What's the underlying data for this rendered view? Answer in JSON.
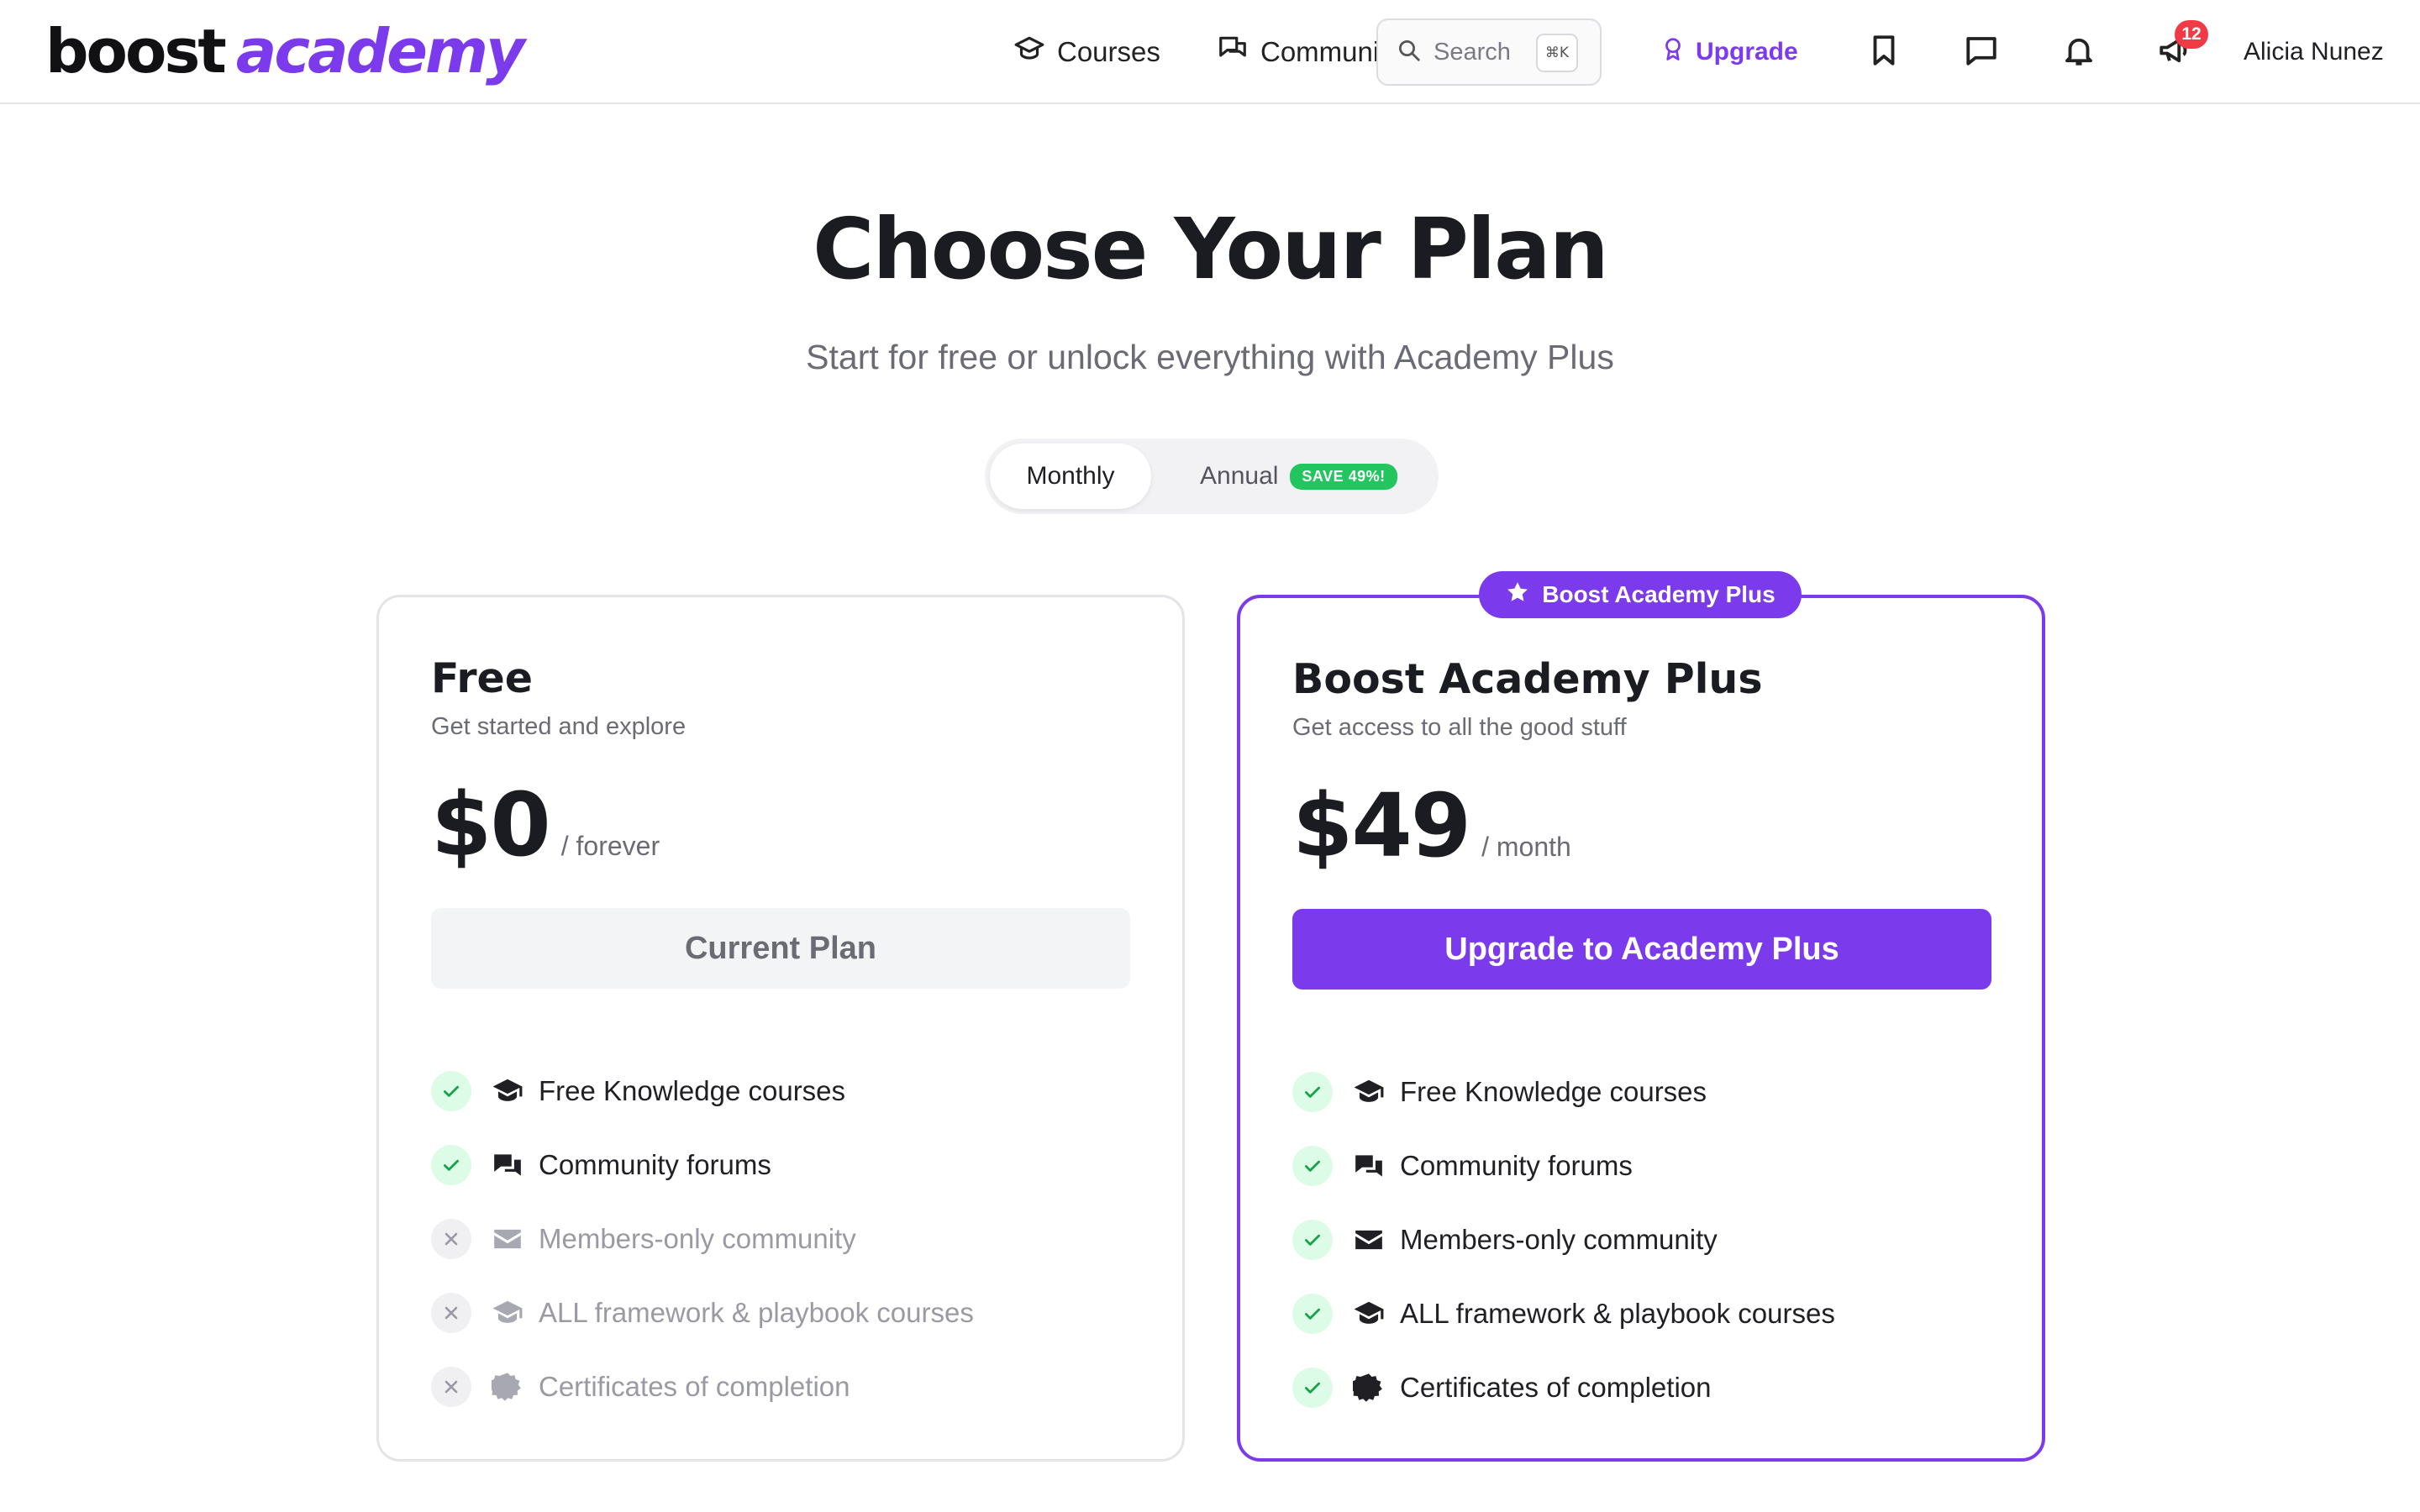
{
  "brand": {
    "logo_left": "boost",
    "logo_right": "academy",
    "accent": "#7c3aed"
  },
  "nav": {
    "courses": "Courses",
    "community": "Community",
    "search_placeholder": "Search",
    "search_shortcut": "⌘K",
    "upgrade": "Upgrade",
    "notification_count": "12",
    "user_name": "Alicia Nunez",
    "icons": [
      "graduation-cap-icon",
      "chat-bubbles-icon",
      "search-icon",
      "award-icon",
      "bookmark-icon",
      "message-icon",
      "bell-icon",
      "megaphone-icon"
    ]
  },
  "hero": {
    "title": "Choose Your Plan",
    "subtitle": "Start for free or unlock everything with Academy Plus"
  },
  "billing": {
    "monthly": "Monthly",
    "annual": "Annual",
    "annual_badge": "SAVE 49%!",
    "selected": "Monthly"
  },
  "plans": {
    "free": {
      "name": "Free",
      "tagline": "Get started and explore",
      "price": "$0",
      "period": "/ forever",
      "cta": "Current Plan",
      "features": [
        {
          "label": "Free Knowledge courses",
          "included": true,
          "icon": "graduation-cap-icon"
        },
        {
          "label": "Community forums",
          "included": true,
          "icon": "chat-bubbles-icon"
        },
        {
          "label": "Members-only community",
          "included": false,
          "icon": "envelope-icon"
        },
        {
          "label": "ALL framework & playbook courses",
          "included": false,
          "icon": "graduation-cap-icon"
        },
        {
          "label": "Certificates of completion",
          "included": false,
          "icon": "certificate-icon"
        }
      ]
    },
    "plus": {
      "badge": "Boost Academy Plus",
      "name": "Boost Academy Plus",
      "tagline": "Get access to all the good stuff",
      "price": "$49",
      "period": "/ month",
      "cta": "Upgrade to Academy Plus",
      "features": [
        {
          "label": "Free Knowledge courses",
          "included": true,
          "icon": "graduation-cap-icon"
        },
        {
          "label": "Community forums",
          "included": true,
          "icon": "chat-bubbles-icon"
        },
        {
          "label": "Members-only community",
          "included": true,
          "icon": "envelope-icon"
        },
        {
          "label": "ALL framework & playbook courses",
          "included": true,
          "icon": "graduation-cap-icon"
        },
        {
          "label": "Certificates of completion",
          "included": true,
          "icon": "certificate-icon"
        }
      ]
    }
  }
}
